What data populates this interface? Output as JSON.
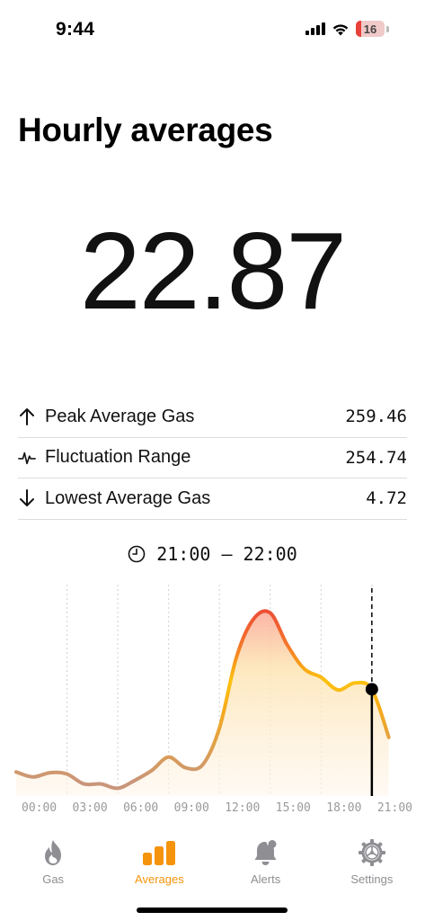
{
  "status_bar": {
    "time": "9:44",
    "battery": "16",
    "battery_color": "#e8403a"
  },
  "page": {
    "title": "Hourly averages",
    "current_value": "22.87"
  },
  "stats": [
    {
      "icon": "arrow-up-icon",
      "label": "Peak Average Gas",
      "value": "259.46"
    },
    {
      "icon": "waveform-icon",
      "label": "Fluctuation Range",
      "value": "254.74"
    },
    {
      "icon": "arrow-down-icon",
      "label": "Lowest Average Gas",
      "value": "4.72"
    }
  ],
  "selection": {
    "icon": "clock-icon",
    "range": "21:00 – 22:00"
  },
  "chart_data": {
    "type": "area",
    "xlabel": "",
    "ylabel": "",
    "x_tick_labels": [
      "00:00",
      "03:00",
      "06:00",
      "09:00",
      "12:00",
      "15:00",
      "18:00",
      "21:00"
    ],
    "x": [
      "00:00",
      "01:00",
      "02:00",
      "03:00",
      "04:00",
      "05:00",
      "06:00",
      "07:00",
      "08:00",
      "09:00",
      "10:00",
      "11:00",
      "12:00",
      "13:00",
      "14:00",
      "15:00",
      "16:00",
      "17:00",
      "18:00",
      "19:00",
      "20:00",
      "21:00",
      "22:00"
    ],
    "values": [
      34,
      27,
      33,
      31,
      17,
      17,
      11,
      22,
      36,
      55,
      40,
      44,
      96,
      196,
      250,
      259,
      214,
      180,
      168,
      150,
      160,
      151,
      83
    ],
    "ylim": [
      0,
      280
    ],
    "selected_x": "21:00",
    "grid": "vertical dotted",
    "colors": {
      "low": "#d09a7a",
      "mid": "#fcc20f",
      "high": "#e8403a",
      "fill_top": "#fbb4a4",
      "fill_bottom": "#fff8ee"
    }
  },
  "tabs": [
    {
      "icon": "flame-icon",
      "label": "Gas",
      "active": false
    },
    {
      "icon": "bar-chart-icon",
      "label": "Averages",
      "active": true
    },
    {
      "icon": "bell-icon",
      "label": "Alerts",
      "active": false
    },
    {
      "icon": "gear-icon",
      "label": "Settings",
      "active": false
    }
  ],
  "colors": {
    "accent": "#f5940c",
    "inactive": "#8e8e93"
  }
}
